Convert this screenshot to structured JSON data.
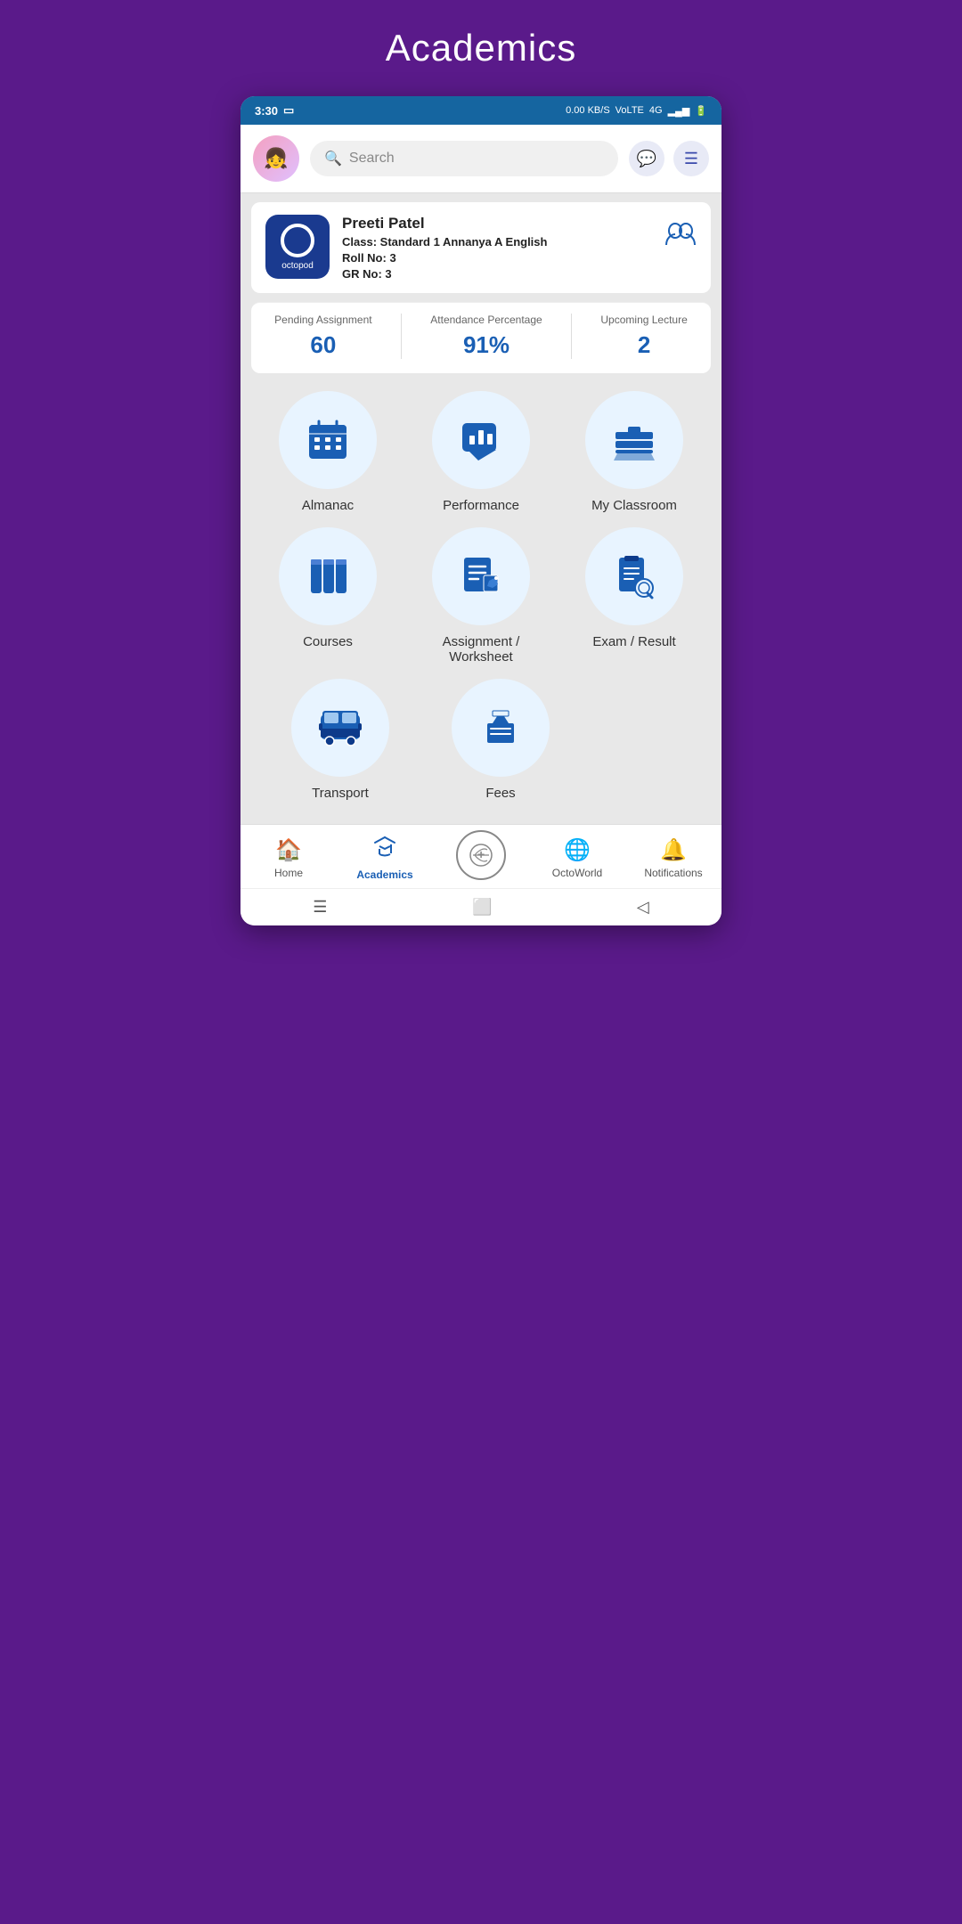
{
  "page": {
    "title": "Academics"
  },
  "status_bar": {
    "time": "3:30",
    "network_speed": "0.00 KB/S",
    "carrier": "VoLTE",
    "signal": "4G"
  },
  "header": {
    "search_placeholder": "Search",
    "search_label": "0 Search"
  },
  "profile": {
    "name": "Preeti Patel",
    "class_label": "Class:",
    "class_value": "Standard 1 Annanya A English",
    "roll_label": "Roll No:",
    "roll_value": "3",
    "gr_label": "GR No:",
    "gr_value": "3",
    "logo_text": "octopod"
  },
  "stats": [
    {
      "label": "Pending Assignment",
      "value": "60"
    },
    {
      "label": "Attendance Percentage",
      "value": "91%"
    },
    {
      "label": "Upcoming Lecture",
      "value": "2"
    }
  ],
  "grid": [
    [
      {
        "id": "almanac",
        "label": "Almanac",
        "icon": "📅"
      },
      {
        "id": "performance",
        "label": "Performance",
        "icon": "📊"
      },
      {
        "id": "my-classroom",
        "label": "My Classroom",
        "icon": "📚"
      }
    ],
    [
      {
        "id": "courses",
        "label": "Courses",
        "icon": "📖"
      },
      {
        "id": "assignment-worksheet",
        "label": "Assignment /\nWorksheet",
        "icon": "📝"
      },
      {
        "id": "exam-result",
        "label": "Exam / Result",
        "icon": "🔍"
      }
    ],
    [
      {
        "id": "transport",
        "label": "Transport",
        "icon": "🚌"
      },
      {
        "id": "fees",
        "label": "Fees",
        "icon": "🎓"
      },
      null
    ]
  ],
  "bottom_nav": [
    {
      "id": "home",
      "label": "Home",
      "icon": "🏠",
      "active": false
    },
    {
      "id": "academics",
      "label": "Academics",
      "icon": "✏️",
      "active": true
    },
    {
      "id": "octoworld-center",
      "label": "",
      "icon": "➕",
      "active": false
    },
    {
      "id": "octoworld",
      "label": "OctoWorld",
      "icon": "🌐",
      "active": false
    },
    {
      "id": "notifications",
      "label": "Notifications",
      "icon": "🔔",
      "active": false
    }
  ]
}
